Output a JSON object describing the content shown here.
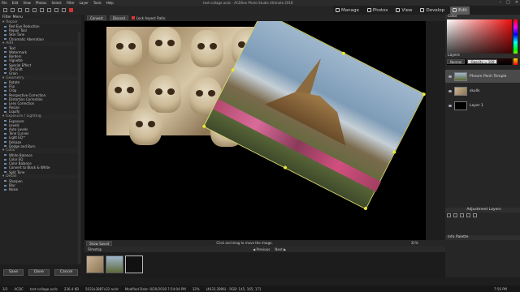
{
  "title_bar": {
    "menu": [
      "File",
      "Edit",
      "View",
      "Photos",
      "Select",
      "Filter",
      "Layer",
      "Tools",
      "Help"
    ],
    "document_title": "test-collage.acdc - ACDSee Photo Studio Ultimate 2018"
  },
  "mode_tabs": [
    {
      "label": "Manage",
      "icon": "grid-icon"
    },
    {
      "label": "Photos",
      "icon": "photos-icon"
    },
    {
      "label": "View",
      "icon": "eye-icon"
    },
    {
      "label": "Develop",
      "icon": "develop-icon"
    },
    {
      "label": "Edit",
      "icon": "edit-icon",
      "active": true
    }
  ],
  "crop_bar": {
    "convert_label": "Convert",
    "discard_label": "Discard",
    "lock_aspect_label": "Lock Aspect Ratio"
  },
  "left_panel": {
    "header": "Filter Menu",
    "sections": [
      {
        "name": "Repair",
        "items": [
          "Red Eye Reduction",
          "Repair Tool",
          "Skin Tune",
          "Chromatic Aberration"
        ]
      },
      {
        "name": "Add",
        "items": [
          "Text",
          "Watermark",
          "Borders",
          "Vignette",
          "Special Effect",
          "Tilt-Shift",
          "Grain"
        ]
      },
      {
        "name": "Geometry",
        "items": [
          "Rotate",
          "Flip",
          "Crop",
          "Perspective Correction",
          "Distortion Correction",
          "Lens Correction",
          "Resize",
          "Liquify"
        ]
      },
      {
        "name": "Exposure / Lighting",
        "items": [
          "Exposure",
          "Levels",
          "Auto Levels",
          "Tone Curves",
          "Light EQ™",
          "Dehaze",
          "Dodge and Burn"
        ]
      },
      {
        "name": "Color",
        "items": [
          "White Balance",
          "Color EQ",
          "Color Balance",
          "Convert to Black & White",
          "Split Tone"
        ]
      },
      {
        "name": "Detail",
        "items": [
          "Sharpen",
          "Blur",
          "Noise"
        ]
      }
    ],
    "buttons": {
      "save": "Save",
      "done": "Done",
      "cancel": "Cancel"
    }
  },
  "canvas": {
    "status_left": "Show Saved",
    "status_center": "Click and drag to move the image.",
    "zoom": "31%"
  },
  "filmstrip": {
    "tab": "Filmstrip",
    "previous_label": "Previous",
    "next_label": "Next"
  },
  "right_panel": {
    "color_header": "Color",
    "layers_header": "Layers",
    "blend_mode": "Normal",
    "opacity": "Opacity = 100",
    "layers": [
      "Phnom Penh Temple",
      "skulls",
      "Layer 1"
    ],
    "adjustment_layers_header": "Adjustment Layers",
    "info_header": "Info Palette"
  },
  "status_bar": {
    "index": "3/3",
    "format": "ACDC",
    "filename": "test-collage.acdc",
    "filesize": "236.4 KB",
    "dimensions": "5033x3887x32 acdc",
    "modified": "Modified Date: 8/20/2018 7:54:04 PM",
    "zoom": "32%",
    "pixel_info": "(4633,2896) - RGB: 145, 165, 171",
    "clock": "7:56 PM"
  },
  "colors": {
    "accent": "#d33333",
    "handle": "#e8e833"
  }
}
